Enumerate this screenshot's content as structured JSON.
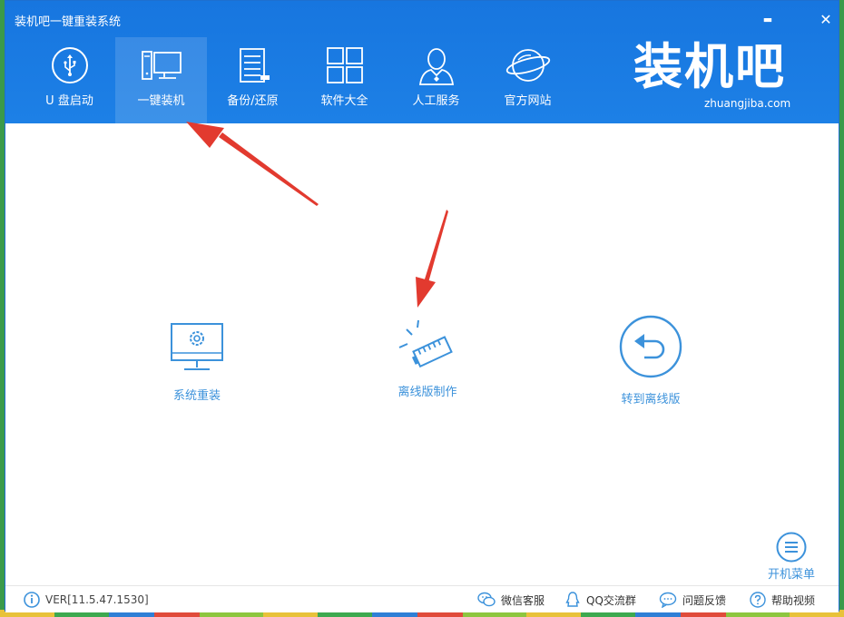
{
  "window": {
    "title": "装机吧一键重装系统",
    "minimize": "▬",
    "close": "✕"
  },
  "nav": [
    {
      "label": "U 盘启动",
      "icon": "usb-icon"
    },
    {
      "label": "一键装机",
      "icon": "computer-icon"
    },
    {
      "label": "备份/还原",
      "icon": "backup-icon"
    },
    {
      "label": "软件大全",
      "icon": "apps-grid-icon"
    },
    {
      "label": "人工服务",
      "icon": "person-icon"
    },
    {
      "label": "官方网站",
      "icon": "planet-icon"
    }
  ],
  "brand": {
    "logo": "装机吧",
    "url": "zhuangjiba.com"
  },
  "actions": [
    {
      "label": "系统重装",
      "icon": "monitor-gear-icon"
    },
    {
      "label": "离线版制作",
      "icon": "network-plug-icon"
    },
    {
      "label": "转到离线版",
      "icon": "return-arrow-icon"
    }
  ],
  "power_menu": {
    "label": "开机菜单",
    "icon": "menu-lines-icon"
  },
  "footer": {
    "version": "VER[11.5.47.1530]",
    "links": [
      {
        "label": "微信客服",
        "icon": "wechat-icon"
      },
      {
        "label": "QQ交流群",
        "icon": "qq-icon"
      },
      {
        "label": "问题反馈",
        "icon": "chat-bubble-icon"
      },
      {
        "label": "帮助视频",
        "icon": "help-icon"
      }
    ]
  },
  "colors": {
    "header": "#1d80e6",
    "accent": "#3c92db",
    "arrow": "#e23a2f"
  }
}
